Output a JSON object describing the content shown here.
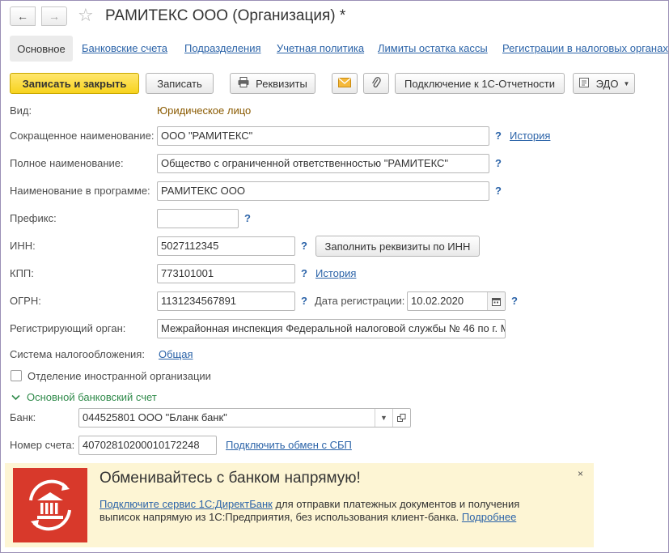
{
  "header": {
    "back_icon": "←",
    "forward_icon": "→",
    "star_icon": "☆",
    "title": "РАМИТЕКС ООО (Организация) *"
  },
  "tabs": [
    {
      "label": "Основное"
    },
    {
      "label": "Банковские счета"
    },
    {
      "label": "Подразделения"
    },
    {
      "label": "Учетная политика"
    },
    {
      "label": "Лимиты остатка кассы"
    },
    {
      "label": "Регистрации в налоговых органах"
    }
  ],
  "toolbar": {
    "save_close": "Записать и закрыть",
    "save": "Записать",
    "requisites": "Реквизиты",
    "connect_1c": "Подключение к 1С-Отчетности",
    "edo": "ЭДО",
    "print_icon": "printer-icon",
    "mail_icon": "envelope-icon",
    "attach_icon": "paperclip-icon",
    "edo_icon": "edo-document-icon"
  },
  "form": {
    "type_label": "Вид:",
    "type_value": "Юридическое лицо",
    "short_name_label": "Сокращенное наименование:",
    "short_name_value": "ООО \"РАМИТЕКС\"",
    "full_name_label": "Полное наименование:",
    "full_name_value": "Общество с ограниченной ответственностью \"РАМИТЕКС\"",
    "prog_name_label": "Наименование в программе:",
    "prog_name_value": "РАМИТЕКС ООО",
    "prefix_label": "Префикс:",
    "prefix_value": "",
    "inn_label": "ИНН:",
    "inn_value": "5027112345",
    "fill_by_inn": "Заполнить реквизиты по ИНН",
    "kpp_label": "КПП:",
    "kpp_value": "773101001",
    "ogrn_label": "ОГРН:",
    "ogrn_value": "1131234567891",
    "reg_date_label": "Дата регистрации:",
    "reg_date_value": "10.02.2020",
    "reg_organ_label": "Регистрирующий орган:",
    "reg_organ_value": "Межрайонная инспекция Федеральной налоговой службы № 46 по г. М",
    "tax_system_label": "Система налогообложения:",
    "tax_system_value": "Общая",
    "foreign_branch_label": "Отделение иностранной организации",
    "history_link": "История",
    "help_mark": "?"
  },
  "bank_section": {
    "title": "Основной банковский счет",
    "bank_label": "Банк:",
    "bank_value": "044525801 ООО \"Бланк банк\"",
    "account_label": "Номер счета:",
    "account_value": "40702810200010172248",
    "sbp_link": "Подключить обмен с СБП"
  },
  "banner": {
    "title": "Обменивайтесь с банком напрямую!",
    "link_text": "Подключите сервис 1С:ДиректБанк",
    "text": " для отправки платежных документов и получения выписок напрямую из 1С:Предприятия, без использования клиент-банка. ",
    "more_link": "Подробнее",
    "close": "×",
    "logo_icon": "bank-exchange-icon"
  },
  "colors": {
    "accent_link": "#2b63a8",
    "primary_button": "#f7d31e",
    "banner_bg": "#fdf5d4",
    "banner_logo": "#d8392b",
    "section_green": "#2f8a4a"
  }
}
